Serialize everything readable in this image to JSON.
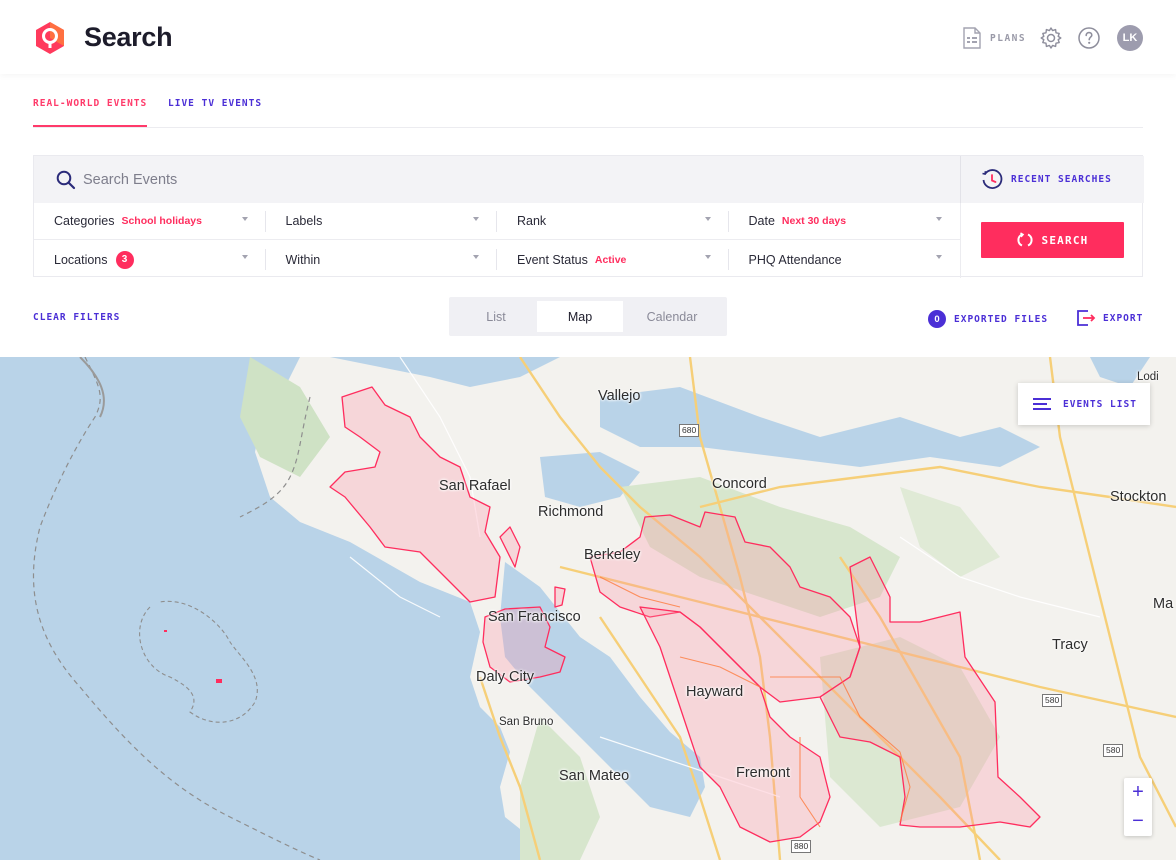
{
  "header": {
    "title": "Search",
    "plans_label": "PLANS",
    "avatar_initials": "LK",
    "brand_color": "#ff3a5c",
    "accent_color": "#4b2fd6"
  },
  "tabs": [
    {
      "label": "REAL-WORLD EVENTS",
      "active": true
    },
    {
      "label": "LIVE TV EVENTS",
      "active": false
    }
  ],
  "search": {
    "placeholder": "Search Events",
    "recent_label": "RECENT SEARCHES",
    "button_label": "SEARCH"
  },
  "filters": {
    "row1": [
      {
        "label": "Categories",
        "value": "School holidays"
      },
      {
        "label": "Labels",
        "value": ""
      },
      {
        "label": "Rank",
        "value": ""
      },
      {
        "label": "Date",
        "value": "Next 30 days"
      }
    ],
    "row2": [
      {
        "label": "Locations",
        "badge": "3"
      },
      {
        "label": "Within",
        "value": ""
      },
      {
        "label": "Event Status",
        "value": "Active"
      },
      {
        "label": "PHQ Attendance",
        "value": ""
      }
    ]
  },
  "toolbar": {
    "clear_filters": "CLEAR FILTERS",
    "views": [
      "List",
      "Map",
      "Calendar"
    ],
    "active_view": "Map",
    "exported_count": "0",
    "exported_label": "EXPORTED FILES",
    "export_label": "EXPORT"
  },
  "map": {
    "events_list_label": "EVENTS LIST",
    "zoom_in": "+",
    "zoom_out": "−",
    "cities": [
      "Vallejo",
      "San Rafael",
      "Richmond",
      "Concord",
      "Stockton",
      "Berkeley",
      "San Francisco",
      "Tracy",
      "Daly City",
      "Hayward",
      "San Bruno",
      "San Mateo",
      "Fremont",
      "Ma",
      "Lodi"
    ],
    "shields": [
      "680",
      "580",
      "580",
      "880"
    ]
  }
}
